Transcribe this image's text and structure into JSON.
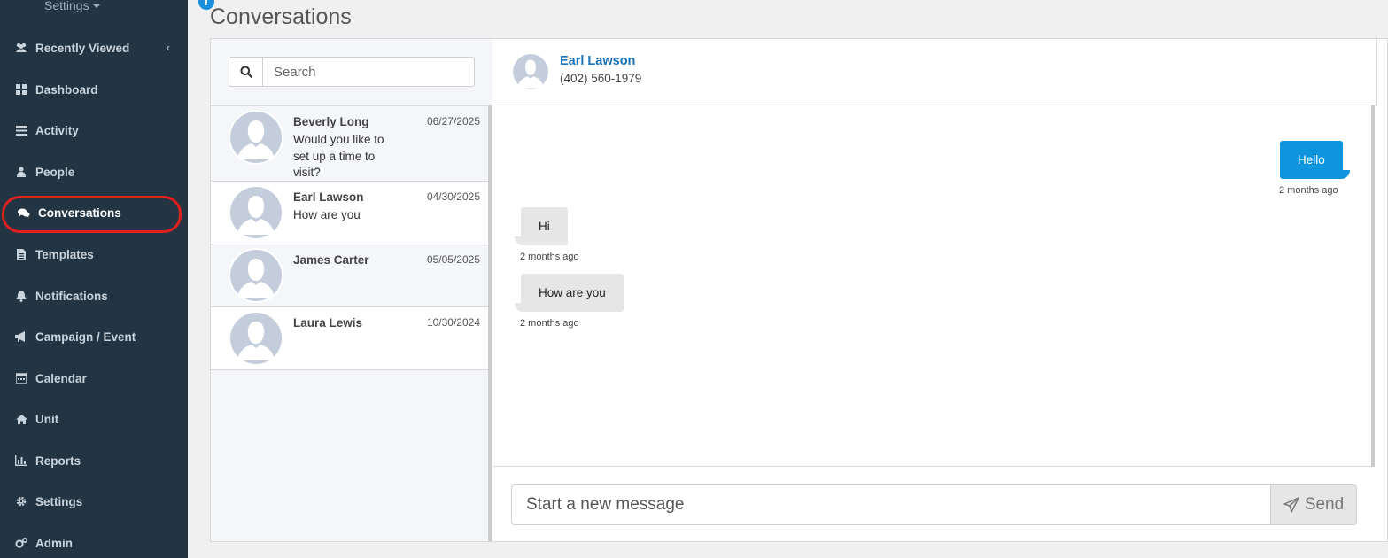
{
  "sidebar": {
    "header_label": "Settings",
    "items": [
      {
        "label": "Recently Viewed",
        "icon": "users-icon"
      },
      {
        "label": "Dashboard",
        "icon": "grid-icon"
      },
      {
        "label": "Activity",
        "icon": "list-icon"
      },
      {
        "label": "People",
        "icon": "person-icon"
      },
      {
        "label": "Conversations",
        "icon": "chat-icon",
        "active": true
      },
      {
        "label": "Templates",
        "icon": "file-icon"
      },
      {
        "label": "Notifications",
        "icon": "bell-icon"
      },
      {
        "label": "Campaign / Event",
        "icon": "megaphone-icon"
      },
      {
        "label": "Calendar",
        "icon": "calendar-icon"
      },
      {
        "label": "Unit",
        "icon": "home-icon"
      },
      {
        "label": "Reports",
        "icon": "bar-chart-icon"
      },
      {
        "label": "Settings",
        "icon": "gear-icon"
      },
      {
        "label": "Admin",
        "icon": "gears-icon"
      }
    ]
  },
  "page": {
    "title": "Conversations",
    "info_glyph": "i"
  },
  "search": {
    "placeholder": "Search",
    "value": ""
  },
  "conversations": [
    {
      "name": "Beverly Long",
      "preview": "Would you like to set up a time to visit?",
      "date": "06/27/2025",
      "selected": true
    },
    {
      "name": "Earl Lawson",
      "preview": "How are you",
      "date": "04/30/2025"
    },
    {
      "name": "James Carter",
      "preview": "",
      "date": "05/05/2025",
      "selected": true
    },
    {
      "name": "Laura Lewis",
      "preview": "",
      "date": "10/30/2024"
    }
  ],
  "chat": {
    "contact_name": "Earl Lawson",
    "contact_phone": "(402) 560-1979",
    "messages": [
      {
        "direction": "out",
        "text": "Hello",
        "time": "2 months ago"
      },
      {
        "direction": "in",
        "text": "Hi",
        "time": "2 months ago"
      },
      {
        "direction": "in",
        "text": "How are you",
        "time": "2 months ago"
      }
    ],
    "composer_placeholder": "Start a new message",
    "send_label": "Send"
  },
  "colors": {
    "sidebar_bg": "#233543",
    "accent_blue": "#0f95dd",
    "link_blue": "#1a73b8",
    "highlight_red": "#e0201e"
  }
}
